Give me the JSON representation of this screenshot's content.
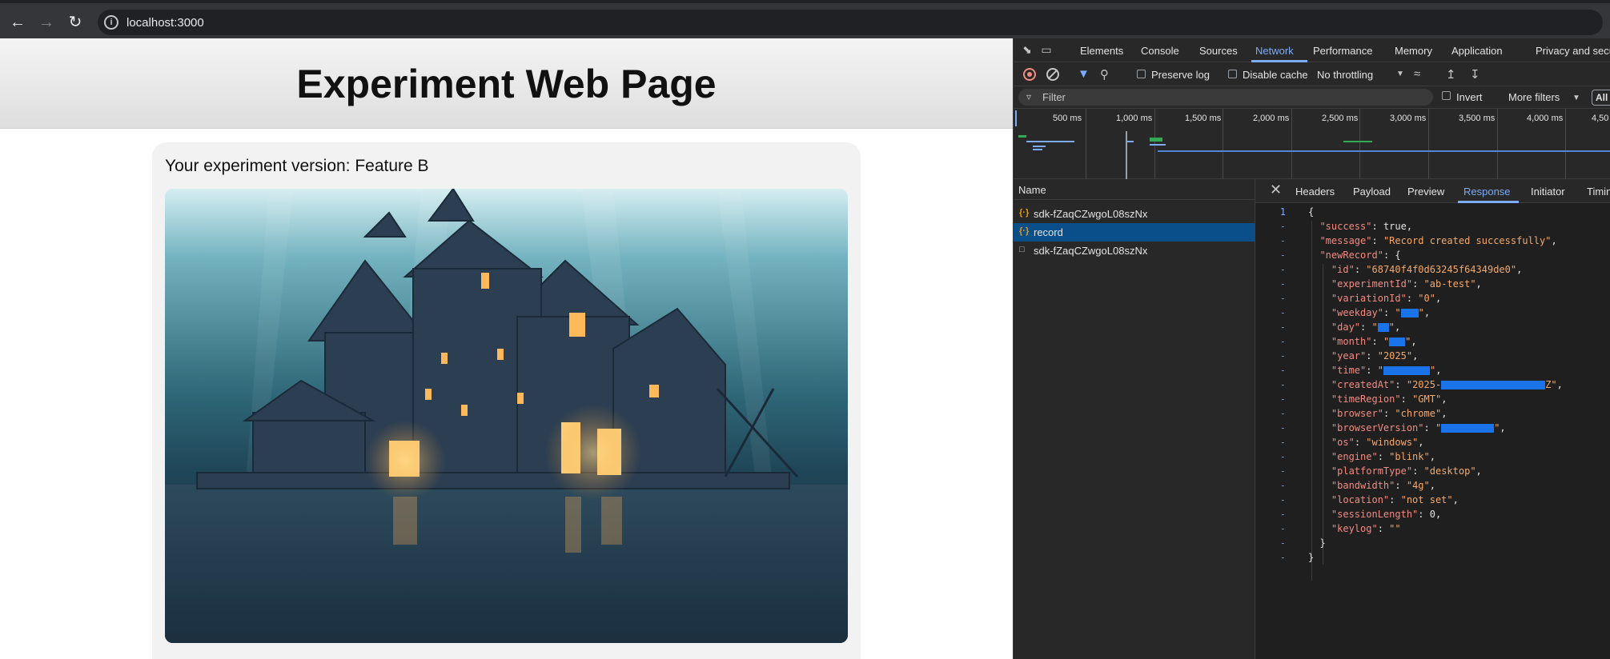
{
  "browser": {
    "url": "localhost:3000"
  },
  "page": {
    "title": "Experiment Web Page",
    "version_text": "Your experiment version: Feature B"
  },
  "devtools": {
    "tabs": [
      "Elements",
      "Console",
      "Sources",
      "Network",
      "Performance",
      "Memory",
      "Application",
      "Privacy and securi"
    ],
    "active_tab": "Network",
    "toolbar": {
      "preserve_log": "Preserve log",
      "disable_cache": "Disable cache",
      "throttling": "No throttling"
    },
    "filter": {
      "placeholder": "Filter",
      "invert": "Invert",
      "more_filters": "More filters",
      "all": "All"
    },
    "timeline_ticks": [
      "500 ms",
      "1,000 ms",
      "1,500 ms",
      "2,000 ms",
      "2,500 ms",
      "3,000 ms",
      "3,500 ms",
      "4,000 ms",
      "4,50"
    ],
    "name_header": "Name",
    "requests": [
      {
        "name": "sdk-fZaqCZwgoL08szNx",
        "type": "fetch",
        "selected": false
      },
      {
        "name": "record",
        "type": "fetch",
        "selected": true
      },
      {
        "name": "sdk-fZaqCZwgoL08szNx",
        "type": "document",
        "selected": false
      }
    ],
    "detail_tabs": [
      "Headers",
      "Payload",
      "Preview",
      "Response",
      "Initiator",
      "Timin"
    ],
    "active_detail_tab": "Response",
    "line_number": "1",
    "response": {
      "success_key": "\"success\"",
      "success_val": "true",
      "message_key": "\"message\"",
      "message_val": "\"Record created successfully\"",
      "newRecord_key": "\"newRecord\"",
      "id_key": "\"id\"",
      "id_val": "\"68740f4f0d63245f64349de0\"",
      "experimentId_key": "\"experimentId\"",
      "experimentId_val": "\"ab-test\"",
      "variationId_key": "\"variationId\"",
      "variationId_val": "\"0\"",
      "weekday_key": "\"weekday\"",
      "day_key": "\"day\"",
      "month_key": "\"month\"",
      "year_key": "\"year\"",
      "year_val": "\"2025\"",
      "time_key": "\"time\"",
      "createdAt_key": "\"createdAt\"",
      "createdAt_prefix": "\"2025-",
      "createdAt_suffix": "Z\"",
      "timeRegion_key": "\"timeRegion\"",
      "timeRegion_val": "\"GMT\"",
      "browser_key": "\"browser\"",
      "browser_val": "\"chrome\"",
      "browserVersion_key": "\"browserVersion\"",
      "os_key": "\"os\"",
      "os_val": "\"windows\"",
      "engine_key": "\"engine\"",
      "engine_val": "\"blink\"",
      "platformType_key": "\"platformType\"",
      "platformType_val": "\"desktop\"",
      "bandwidth_key": "\"bandwidth\"",
      "bandwidth_val": "\"4g\"",
      "location_key": "\"location\"",
      "location_val": "\"not set\"",
      "sessionLength_key": "\"sessionLength\"",
      "sessionLength_val": "0",
      "keylog_key": "\"keylog\"",
      "keylog_val": "\"\""
    }
  }
}
